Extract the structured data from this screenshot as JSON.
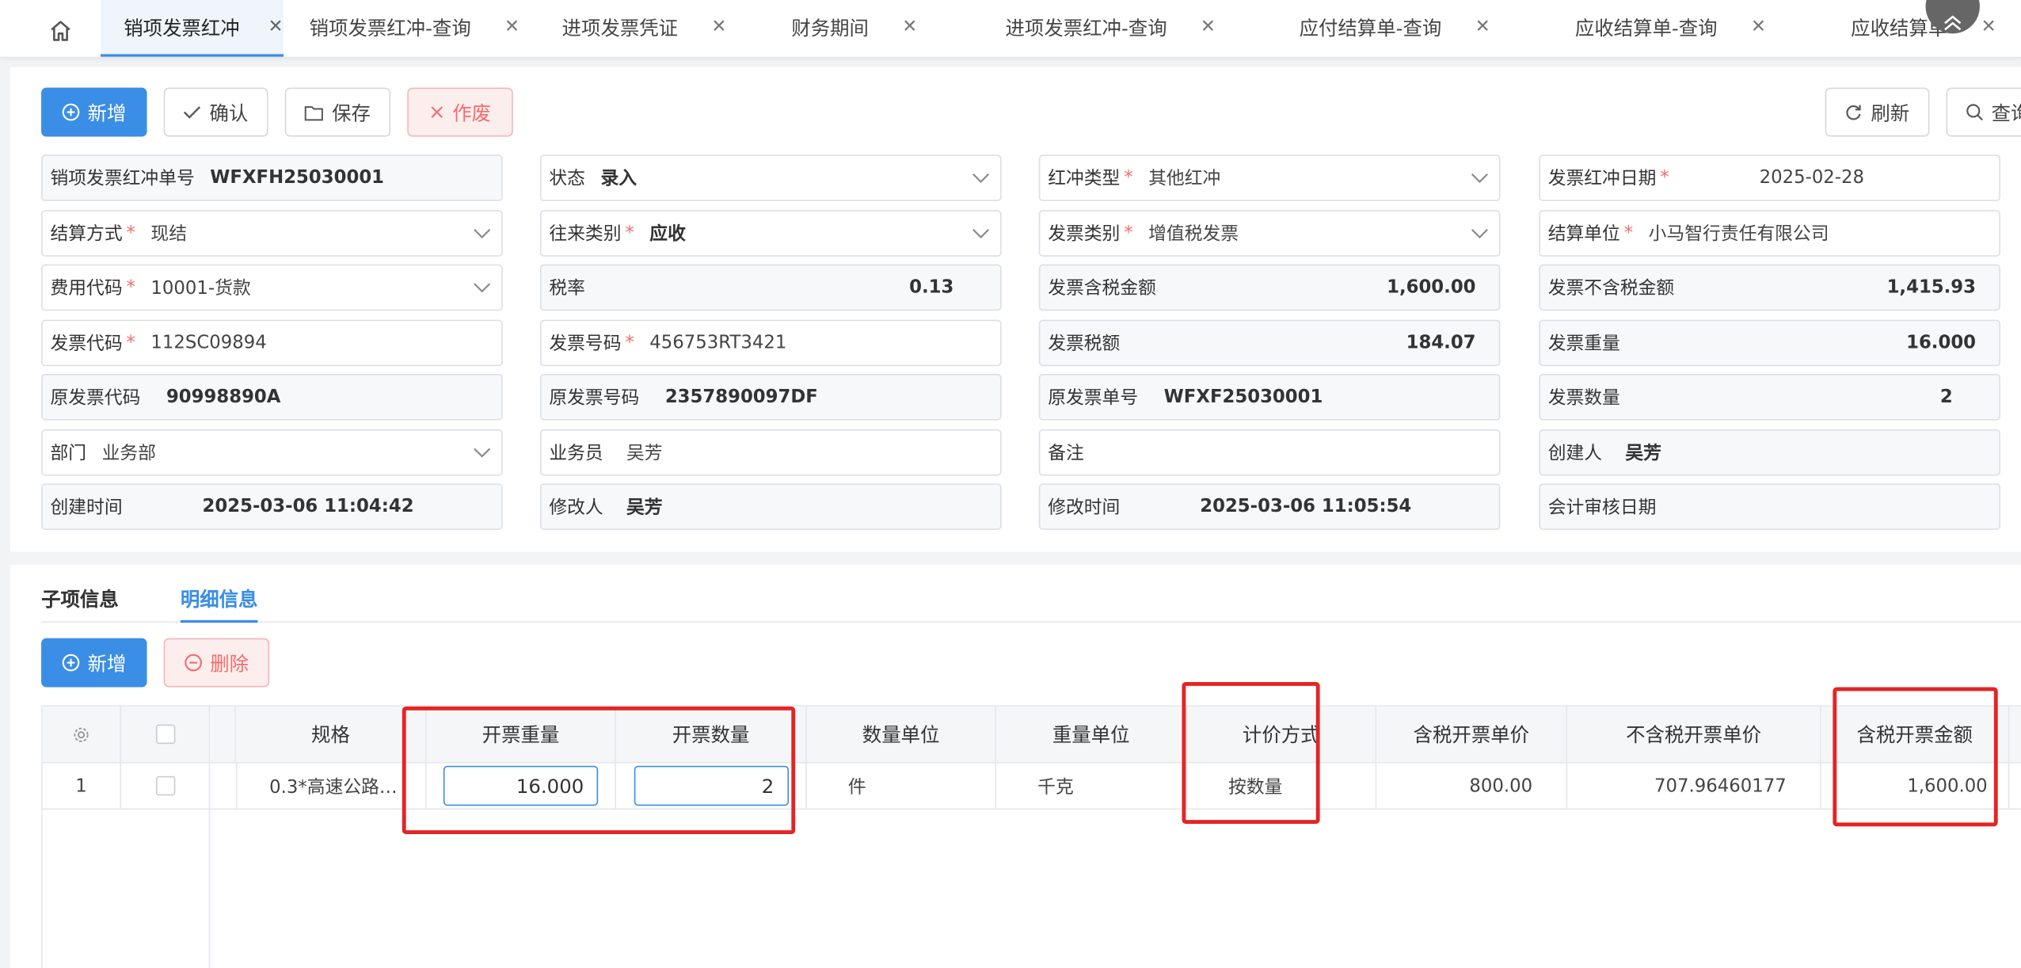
{
  "tabs": [
    {
      "label": "销项发票红冲",
      "active": true
    },
    {
      "label": "销项发票红冲-查询"
    },
    {
      "label": "进项发票凭证"
    },
    {
      "label": "财务期间"
    },
    {
      "label": "进项发票红冲-查询"
    },
    {
      "label": "应付结算单-查询"
    },
    {
      "label": "应收结算单-查询"
    },
    {
      "label": "应收结算单"
    }
  ],
  "toolbar": {
    "add": "新增",
    "confirm": "确认",
    "save": "保存",
    "void": "作废",
    "refresh": "刷新",
    "query": "查询"
  },
  "form": {
    "no_label": "销项发票红冲单号",
    "no_value": "WFXFH25030001",
    "status_label": "状态",
    "status_value": "录入",
    "redtype_label": "红冲类型",
    "redtype_value": "其他红冲",
    "reddate_label": "发票红冲日期",
    "reddate_value": "2025-02-28",
    "settle_label": "结算方式",
    "settle_value": "现结",
    "deal_label": "往来类别",
    "deal_value": "应收",
    "invtype_label": "发票类别",
    "invtype_value": "增值税发票",
    "unit_label": "结算单位",
    "unit_value": "小马智行责任有限公司",
    "fee_label": "费用代码",
    "fee_value": "10001-货款",
    "rate_label": "税率",
    "rate_value": "0.13",
    "taxamt_label": "发票含税金额",
    "taxamt_value": "1,600.00",
    "notaxamt_label": "发票不含税金额",
    "notaxamt_value": "1,415.93",
    "code_label": "发票代码",
    "code_value": "112SC09894",
    "num_label": "发票号码",
    "num_value": "456753RT3421",
    "tax_label": "发票税额",
    "tax_value": "184.07",
    "weight_label": "发票重量",
    "weight_value": "16.000",
    "origcode_label": "原发票代码",
    "origcode_value": "90998890A",
    "orignum_label": "原发票号码",
    "orignum_value": "2357890097DF",
    "origno_label": "原发票单号",
    "origno_value": "WFXF25030001",
    "qty_label": "发票数量",
    "qty_value": "2",
    "dept_label": "部门",
    "dept_value": "业务部",
    "sales_label": "业务员",
    "sales_value": "吴芳",
    "remark_label": "备注",
    "creator_label": "创建人",
    "creator_value": "吴芳",
    "ctime_label": "创建时间",
    "ctime_value": "2025-03-06 11:04:42",
    "modifier_label": "修改人",
    "modifier_value": "吴芳",
    "mtime_label": "修改时间",
    "mtime_value": "2025-03-06 11:05:54",
    "audit_label": "会计审核日期"
  },
  "detail": {
    "tab_sub": "子项信息",
    "tab_detail": "明细信息",
    "add": "新增",
    "delete": "删除",
    "columns": [
      "规格",
      "开票重量",
      "开票数量",
      "数量单位",
      "重量单位",
      "计价方式",
      "含税开票单价",
      "不含税开票单价",
      "含税开票金额"
    ],
    "row": {
      "index": "1",
      "spec": "0.3*高速公路…",
      "weight": "16.000",
      "qty": "2",
      "qty_unit": "件",
      "weight_unit": "千克",
      "pricing": "按数量",
      "tax_price": "800.00",
      "notax_price": "707.96460177",
      "tax_amount": "1,600.00"
    }
  }
}
